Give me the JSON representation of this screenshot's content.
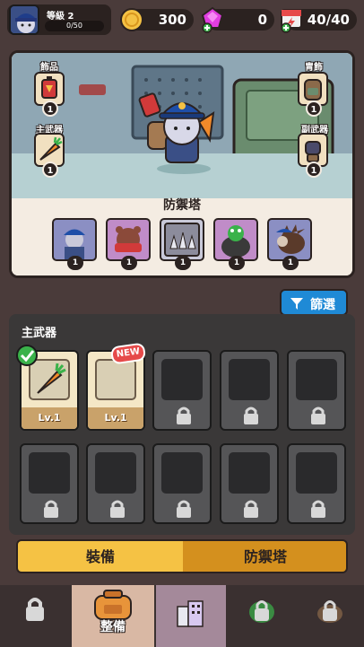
{
  "top_bar": {
    "level_label": "等級 2",
    "exp_text": "0/50",
    "coins": "300",
    "gems": "0",
    "energy": "40/40"
  },
  "scene": {
    "slots": [
      {
        "label": "飾品",
        "count": "1"
      },
      {
        "label": "主武器",
        "count": "1"
      },
      {
        "label": "胄飾",
        "count": "1"
      },
      {
        "label": "副武器",
        "count": "1"
      }
    ],
    "tower_title": "防禦塔",
    "towers": [
      {
        "name": "blue-cap-gunner",
        "count": "1"
      },
      {
        "name": "bear-tank",
        "count": "1"
      },
      {
        "name": "spike-trap",
        "count": "1"
      },
      {
        "name": "frog-cauldron",
        "count": "1"
      },
      {
        "name": "hedgehog-spiker",
        "count": "1"
      }
    ]
  },
  "filter": {
    "label": "篩選"
  },
  "inventory": {
    "title": "主武器",
    "items": [
      {
        "level": "Lv.1",
        "equipped": true,
        "new": false
      },
      {
        "level": "Lv.1",
        "equipped": false,
        "new": true
      }
    ],
    "new_badge": "NEW"
  },
  "toggle": {
    "left": "裝備",
    "right": "防禦塔"
  },
  "nav": {
    "active_label": "整備"
  },
  "colors": {
    "accent": "#f5c244",
    "filter": "#1f8ad6"
  }
}
